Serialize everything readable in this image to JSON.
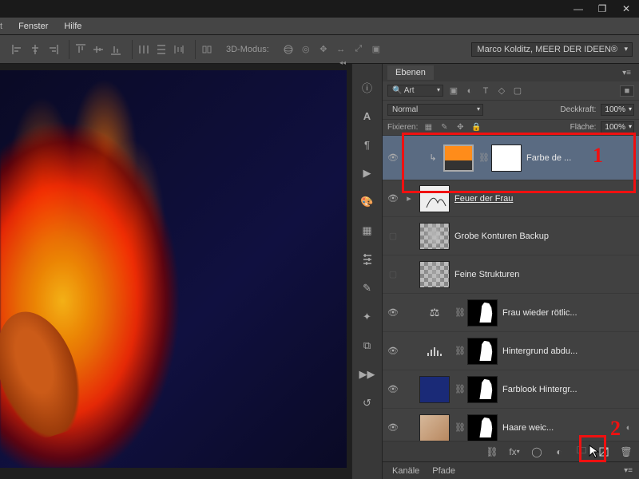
{
  "window": {
    "min": "—",
    "restore": "❐",
    "close": "✕"
  },
  "menu": {
    "fenster": "Fenster",
    "hilfe": "Hilfe"
  },
  "options": {
    "mode3d_label": "3D-Modus:",
    "brand": "Marco Kolditz, MEER DER IDEEN®"
  },
  "panel": {
    "tab": "Ebenen",
    "search_label": "Art",
    "blend_mode": "Normal",
    "opacity_label": "Deckkraft:",
    "opacity_val": "100%",
    "fill_label": "Fläche:",
    "fill_val": "100%",
    "lock_label": "Fixieren:"
  },
  "layers": [
    {
      "name": "Farbe de ...",
      "type": "color-fill",
      "visible": true,
      "selected": true,
      "clipped": true,
      "mask": "white",
      "thumb": "color-fill"
    },
    {
      "name": "Feuer der Frau",
      "type": "smart",
      "visible": true,
      "mask": false,
      "thumb": "fire",
      "underline": true
    },
    {
      "name": "Grobe Konturen Backup",
      "type": "raster",
      "visible": false,
      "thumb": "checker"
    },
    {
      "name": "Feine Strukturen",
      "type": "raster",
      "visible": false,
      "thumb": "checker"
    },
    {
      "name": "Frau wieder rötlic...",
      "type": "adjust",
      "visible": true,
      "mask": "sil",
      "thumb": "balance"
    },
    {
      "name": "Hintergrund abdu...",
      "type": "adjust",
      "visible": true,
      "mask": "sil",
      "thumb": "levels"
    },
    {
      "name": "Farblook Hintergr...",
      "type": "color-fill",
      "visible": true,
      "mask": "sil",
      "thumb": "blue"
    },
    {
      "name": "Haare weic...",
      "type": "raster",
      "visible": true,
      "mask": "sil",
      "thumb": "photo"
    }
  ],
  "bottom_tabs": {
    "kanale": "Kanäle",
    "pfade": "Pfade"
  },
  "annotations": {
    "n1": "1",
    "n2": "2"
  }
}
